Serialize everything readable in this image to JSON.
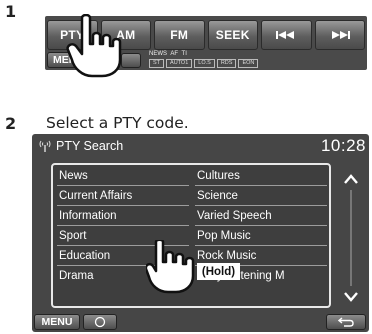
{
  "steps": [
    {
      "number": "1",
      "text": ""
    },
    {
      "number": "2",
      "text": "Select a PTY code."
    }
  ],
  "control_strip": {
    "buttons": [
      "PTY",
      "AM",
      "FM",
      "SEEK"
    ],
    "prev_icon": "skip-back-icon",
    "next_icon": "skip-forward-icon",
    "menu_label": "MENU",
    "indicators_top": "NEWS  AF  TI",
    "indicators_boxes": [
      "ST",
      "AUTO1",
      "LO.S",
      "RDS",
      "EON"
    ]
  },
  "pty_screen": {
    "title": "PTY Search",
    "clock": "10:28",
    "left_column": [
      "News",
      "Current Affairs",
      "Information",
      "Sport",
      "Education",
      "Drama"
    ],
    "right_column": [
      "Cultures",
      "Science",
      "Varied Speech",
      "Pop Music",
      "Rock Music",
      "Easy Listening M"
    ],
    "menu_label": "MENU",
    "hold_label": "(Hold)"
  },
  "colors": {
    "panel": "#464646",
    "button": "#5e5e5e",
    "text": "#ffffff"
  }
}
